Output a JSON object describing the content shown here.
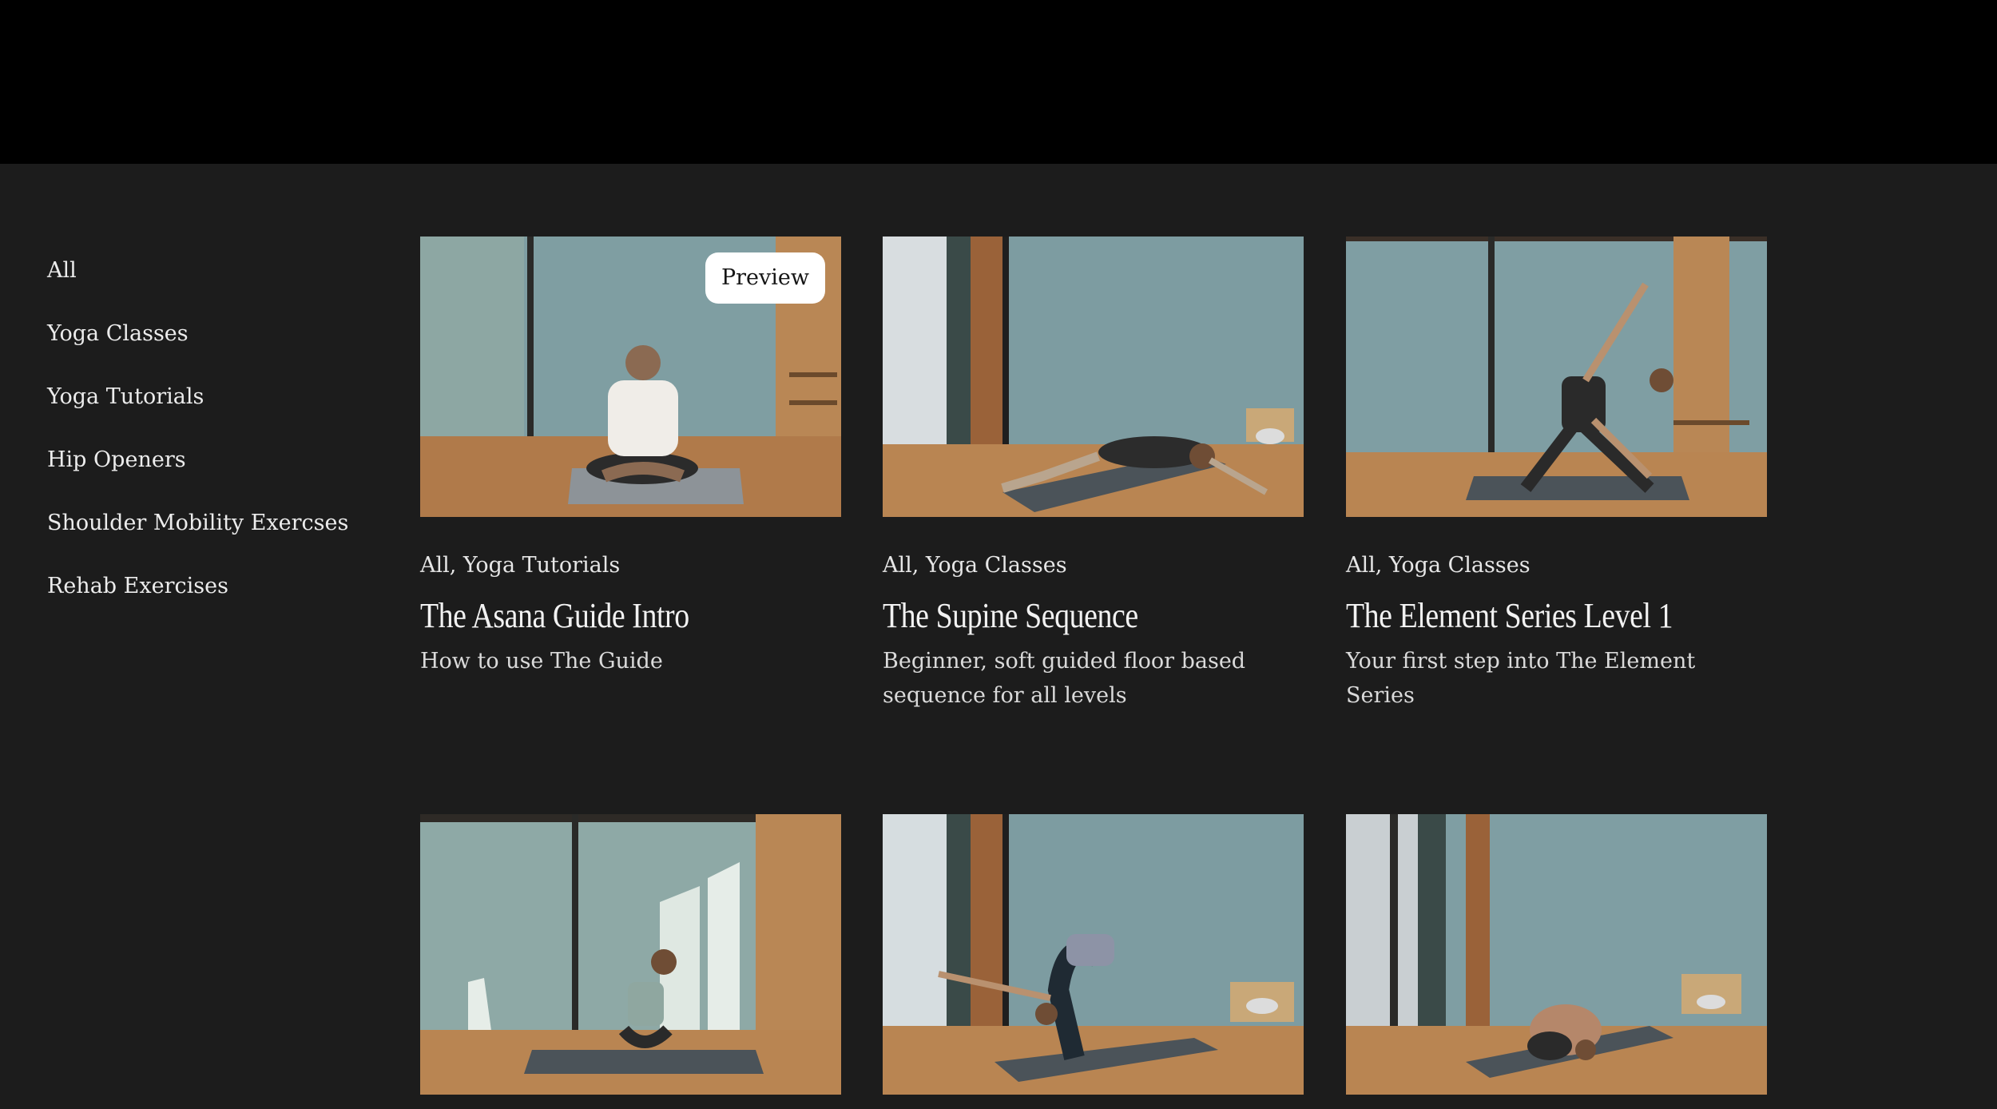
{
  "sidebar": {
    "items": [
      {
        "label": "All"
      },
      {
        "label": "Yoga Classes"
      },
      {
        "label": "Yoga Tutorials"
      },
      {
        "label": "Hip Openers"
      },
      {
        "label": "Shoulder Mobility Exercses"
      },
      {
        "label": "Rehab Exercises"
      }
    ]
  },
  "cards": [
    {
      "badge": "Preview",
      "tags": "All, Yoga Tutorials",
      "title": "The Asana Guide Intro",
      "description": "How to use The Guide",
      "pose": "seated meditation"
    },
    {
      "tags": "All, Yoga Classes",
      "title": "The Supine Sequence",
      "description": "Beginner, soft guided floor based sequence for all levels",
      "pose": "supine twist"
    },
    {
      "tags": "All, Yoga Classes",
      "title": "The Element Series Level 1",
      "description": "Your first step into The Element Series",
      "pose": "triangle"
    },
    {
      "pose": "squat"
    },
    {
      "pose": "standing forward fold"
    },
    {
      "pose": "child's pose"
    }
  ],
  "colors": {
    "header": "#000000",
    "background": "#1c1c1c",
    "wall": "#7f9ea2",
    "floor": "#b07a4a",
    "mat": "#4b5359"
  }
}
